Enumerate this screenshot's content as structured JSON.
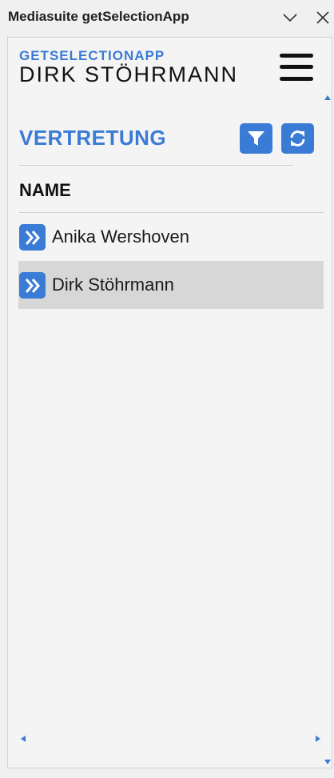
{
  "window": {
    "title": "Mediasuite getSelectionApp"
  },
  "header": {
    "app_name": "GETSELECTIONAPP",
    "user_name": "DIRK STÖHRMANN"
  },
  "section": {
    "title": "VERTRETUNG",
    "column_header": "NAME"
  },
  "list": {
    "items": [
      {
        "label": "Anika Wershoven",
        "selected": false
      },
      {
        "label": "Dirk Stöhrmann",
        "selected": true
      }
    ]
  },
  "icons": {
    "titlebar": [
      "chevron-down-icon",
      "close-icon"
    ],
    "toolbar": [
      "hamburger-menu-icon",
      "filter-icon",
      "refresh-icon"
    ],
    "row": "double-chevron-right-icon"
  },
  "colors": {
    "accent": "#3a7bd5",
    "selected_row": "#d7d7d7",
    "background": "#f4f4f4"
  }
}
